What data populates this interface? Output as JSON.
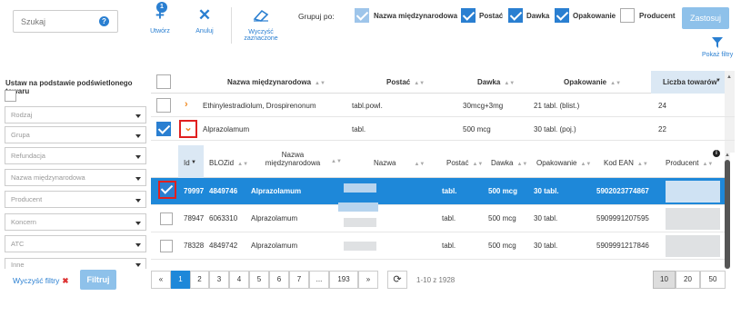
{
  "search": {
    "placeholder": "Szukaj"
  },
  "toolbar": {
    "create_label": "Utwórz",
    "create_badge": "1",
    "cancel_label": "Anuluj",
    "clear_selected_label_line1": "Wyczyść",
    "clear_selected_label_line2": "zaznaczone"
  },
  "group_by": {
    "label": "Grupuj po:",
    "options": [
      {
        "label": "Nazwa międzynarodowa",
        "checked": true
      },
      {
        "label": "Postać",
        "checked": true
      },
      {
        "label": "Dawka",
        "checked": true
      },
      {
        "label": "Opakowanie",
        "checked": true
      },
      {
        "label": "Producent",
        "checked": false
      }
    ],
    "apply_label": "Zastosuj",
    "show_filters_label": "Pokaż filtry"
  },
  "left_panel": {
    "title": "Ustaw na podstawie podświetlonego towaru",
    "filters": [
      "Rodzaj",
      "Grupa",
      "Refundacja",
      "Nazwa międzynarodowa",
      "Producent",
      "Koncern",
      "ATC",
      "Inne"
    ],
    "clear_label": "Wyczyść filtry",
    "filter_label": "Filtruj"
  },
  "group_table": {
    "headers": {
      "name": "Nazwa międzynarodowa",
      "form": "Postać",
      "dose": "Dawka",
      "pack": "Opakowanie",
      "count": "Liczba towarów"
    },
    "rows": [
      {
        "name": "Ethinylestradiolum, Drospirenonum",
        "form": "tabl.powl.",
        "dose": "30mcg+3mg",
        "pack": "21 tabl. (blist.)",
        "count": "24"
      },
      {
        "name": "Alprazolamum",
        "form": "tabl.",
        "dose": "500 mcg",
        "pack": "30 tabl. (poj.)",
        "count": "22"
      }
    ]
  },
  "detail_table": {
    "headers": {
      "id": "Id",
      "bloz": "BLOZid",
      "intl_line1": "Nazwa",
      "intl_line2": "międzynarodowa",
      "name": "Nazwa",
      "form": "Postać",
      "dose": "Dawka",
      "pack": "Opakowanie",
      "ean": "Kod EAN",
      "producer": "Producent"
    },
    "rows": [
      {
        "id": "79997",
        "bloz": "4849746",
        "intl": "Alprazolamum",
        "form": "tabl.",
        "dose": "500 mcg",
        "pack": "30 tabl.",
        "ean": "5902023774867"
      },
      {
        "id": "78947",
        "bloz": "6063310",
        "intl": "Alprazolamum",
        "form": "tabl.",
        "dose": "500 mcg",
        "pack": "30 tabl.",
        "ean": "5909991207595"
      },
      {
        "id": "78328",
        "bloz": "4849742",
        "intl": "Alprazolamum",
        "form": "tabl.",
        "dose": "500 mcg",
        "pack": "30 tabl.",
        "ean": "5909991217846"
      }
    ]
  },
  "pagination": {
    "prev": "«",
    "pages": [
      "1",
      "2",
      "3",
      "4",
      "5",
      "6",
      "7",
      "...",
      "193"
    ],
    "next": "»",
    "range": "1-10 z 1928",
    "sizes": [
      "10",
      "20",
      "50"
    ]
  },
  "colors": {
    "accent": "#1e88d9",
    "button_light": "#8ec1ea",
    "highlight_red": "#e02020"
  }
}
